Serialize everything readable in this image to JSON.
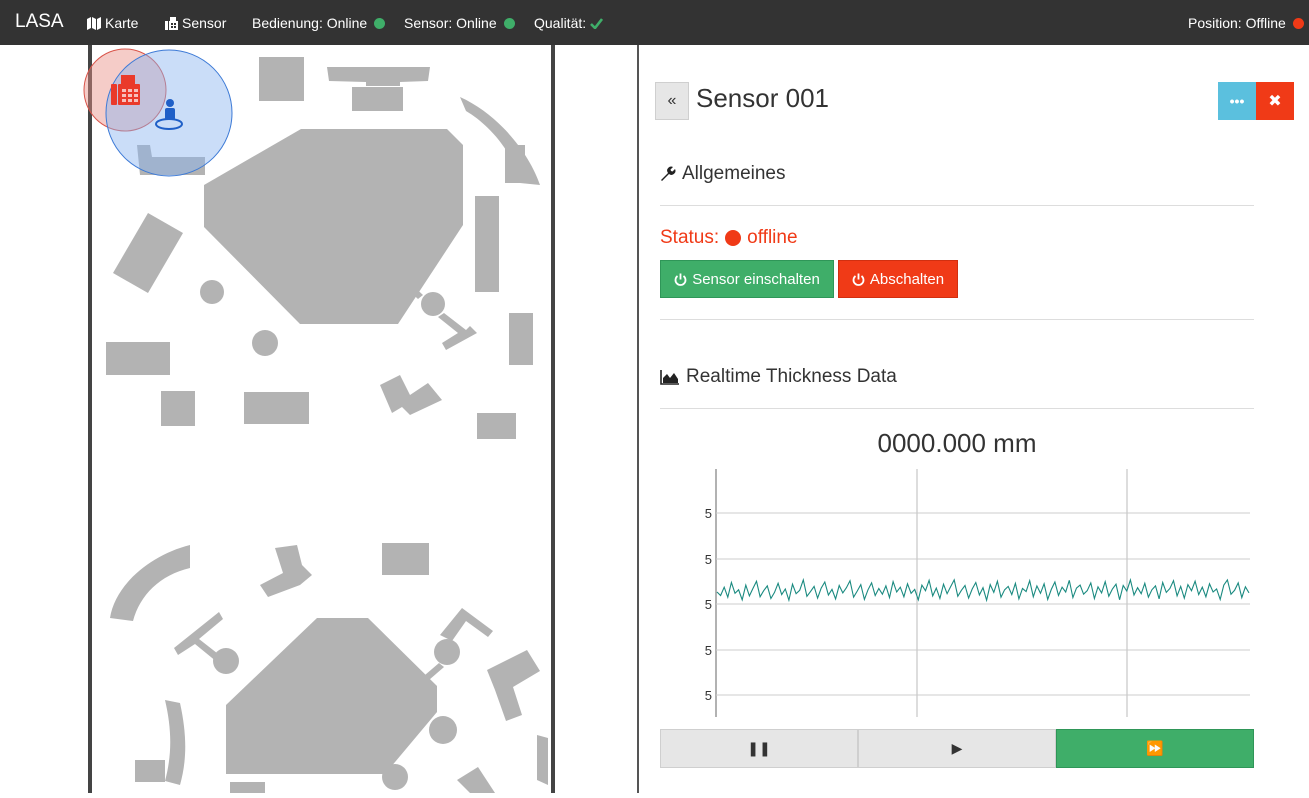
{
  "navbar": {
    "brand": "LASA",
    "items": [
      {
        "label": "Karte",
        "icon": "map-icon"
      },
      {
        "label": "Sensor",
        "icon": "fax-icon"
      }
    ],
    "statuses": [
      {
        "label": "Bedienung: Online",
        "state": "online"
      },
      {
        "label": "Sensor: Online",
        "state": "online"
      },
      {
        "label": "Qualität:",
        "state": "ok"
      }
    ],
    "position": {
      "label": "Position: Offline",
      "state": "offline"
    }
  },
  "colors": {
    "navbar": "#333333",
    "online": "#3fae69",
    "offline": "#f03a17",
    "info": "#5bc0de",
    "buildings": "#b3b3b3",
    "chart_line": "#1a8a80",
    "sensor_zone": "#f2a9a0",
    "user_zone": "#a9c8f5"
  },
  "panel": {
    "back_label": "«",
    "title": "Sensor 001",
    "more_label": "•••",
    "close_label": "✖",
    "general_section": "Allgemeines",
    "status_prefix": "Status:",
    "status_value": "offline",
    "btn_on": "Sensor einschalten",
    "btn_off": "Abschalten",
    "realtime_section": "Realtime Thickness Data",
    "reading": "0000.000 mm"
  },
  "controls": {
    "pause": "❚❚",
    "play": "▶",
    "fast_forward": "⏩"
  },
  "chart_data": {
    "type": "line",
    "y_tick_labels": [
      "5",
      "5",
      "5",
      "5",
      "5"
    ],
    "series": [
      {
        "values": [
          0.3,
          0.22,
          0.41,
          0.18,
          0.52,
          0.27,
          0.35,
          0.12,
          0.46,
          0.21,
          0.38,
          0.55,
          0.19,
          0.33,
          0.44,
          0.15,
          0.29,
          0.5,
          0.24,
          0.37,
          0.11,
          0.48,
          0.26,
          0.34,
          0.58,
          0.2,
          0.31,
          0.43,
          0.16,
          0.39,
          0.53,
          0.23,
          0.36,
          0.14,
          0.45,
          0.28,
          0.4,
          0.56,
          0.18,
          0.32,
          0.47,
          0.13,
          0.35,
          0.51,
          0.22,
          0.38,
          0.25,
          0.44,
          0.17,
          0.54,
          0.3,
          0.41,
          0.19,
          0.49,
          0.27,
          0.36,
          0.12,
          0.46,
          0.33,
          0.57,
          0.21,
          0.39,
          0.15,
          0.48,
          0.26,
          0.42,
          0.58,
          0.2,
          0.34,
          0.45,
          0.16,
          0.37,
          0.52,
          0.23,
          0.4,
          0.11,
          0.47,
          0.29,
          0.55,
          0.18,
          0.35,
          0.43,
          0.24,
          0.5,
          0.14,
          0.38,
          0.31,
          0.56,
          0.19,
          0.44,
          0.27,
          0.49,
          0.13,
          0.36,
          0.53,
          0.22,
          0.41,
          0.3,
          0.57,
          0.17,
          0.39,
          0.46,
          0.25,
          0.33,
          0.51,
          0.15,
          0.42,
          0.28,
          0.54,
          0.2,
          0.37,
          0.48,
          0.12,
          0.45,
          0.32,
          0.58,
          0.23,
          0.4,
          0.26,
          0.5,
          0.18,
          0.35,
          0.44,
          0.14,
          0.52,
          0.29,
          0.38,
          0.56,
          0.21,
          0.43,
          0.16,
          0.47,
          0.33,
          0.55,
          0.24,
          0.41,
          0.19,
          0.49,
          0.3,
          0.37,
          0.13,
          0.46,
          0.58,
          0.25,
          0.34,
          0.51,
          0.17,
          0.42,
          0.28
        ]
      }
    ]
  }
}
